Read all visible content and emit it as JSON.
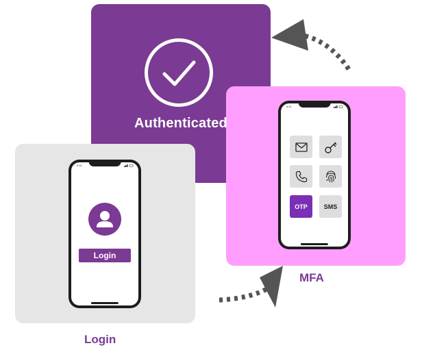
{
  "authenticated": {
    "label": "Authenticated"
  },
  "login_phone": {
    "status_time": "9:41",
    "button_label": "Login"
  },
  "mfa_phone": {
    "status_time": "9:41",
    "tiles": [
      {
        "icon": "mail-icon"
      },
      {
        "icon": "key-icon"
      },
      {
        "icon": "phone-icon"
      },
      {
        "icon": "fingerprint-icon"
      },
      {
        "label": "OTP"
      },
      {
        "label": "SMS"
      }
    ]
  },
  "captions": {
    "login": "Login",
    "mfa": "MFA"
  },
  "colors": {
    "purple": "#7b3a93",
    "pink": "#ff9eff",
    "gray": "#e6e6e6",
    "otp": "#7b2fb5"
  }
}
